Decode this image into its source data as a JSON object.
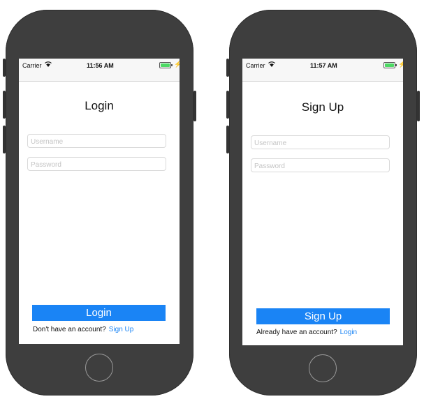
{
  "phones": [
    {
      "status": {
        "carrier": "Carrier",
        "time": "11:56 AM"
      },
      "title": "Login",
      "fields": {
        "username_placeholder": "Username",
        "password_placeholder": "Password"
      },
      "primary_button": "Login",
      "footer": {
        "text": "Don't have an account?",
        "link": "Sign Up"
      }
    },
    {
      "status": {
        "carrier": "Carrier",
        "time": "11:57 AM"
      },
      "title": "Sign Up",
      "fields": {
        "username_placeholder": "Username",
        "password_placeholder": "Password"
      },
      "primary_button": "Sign Up",
      "footer": {
        "text": "Already have an account?",
        "link": "Login"
      }
    }
  ],
  "colors": {
    "accent": "#1a84f5",
    "battery": "#4cd964",
    "phone_body": "#3e3e3e"
  }
}
